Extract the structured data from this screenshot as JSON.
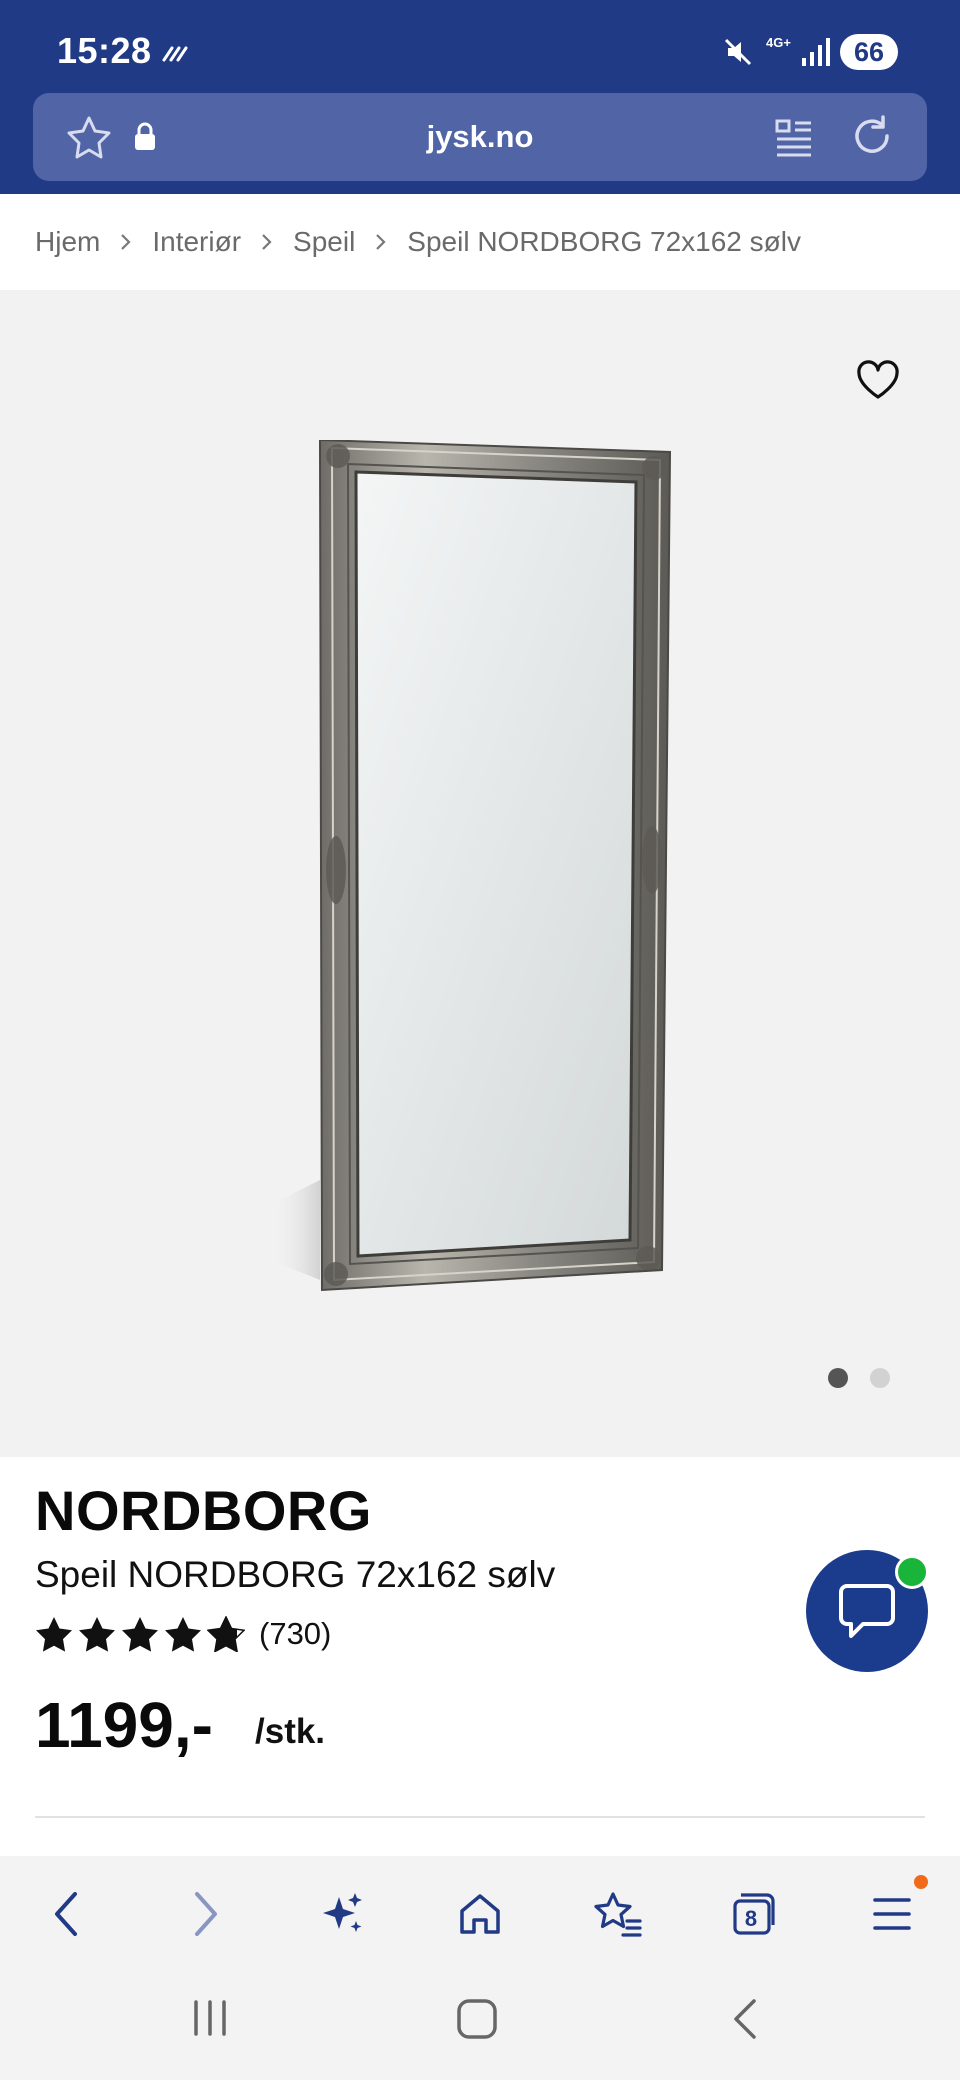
{
  "status_bar": {
    "time": "15:28",
    "network": "4G+",
    "battery": "66",
    "icons": [
      "sync-icon",
      "mute-icon",
      "network-icon",
      "signal-icon",
      "battery-icon"
    ]
  },
  "browser": {
    "url": "jysk.no",
    "tabs_count": "8",
    "toolbar_icons": [
      "back-icon",
      "forward-icon",
      "ai-sparkle-icon",
      "home-icon",
      "bookmarks-icon",
      "tabs-icon",
      "menu-icon"
    ]
  },
  "breadcrumb": [
    {
      "label": "Hjem"
    },
    {
      "label": "Interiør"
    },
    {
      "label": "Speil"
    },
    {
      "label": "Speil NORDBORG 72x162 sølv"
    }
  ],
  "gallery": {
    "current_image": 1,
    "image_count": 2
  },
  "product": {
    "brand": "NORDBORG",
    "name": "Speil NORDBORG 72x162 sølv",
    "rating": 4.8,
    "rating_max": 5,
    "review_count": "(730)",
    "price": "1199,-",
    "unit": "/stk."
  },
  "colors": {
    "brand_blue": "#213a86",
    "chat_blue": "#1b3c8d",
    "online_green": "#19b43a",
    "badge_orange": "#f06a1a"
  }
}
